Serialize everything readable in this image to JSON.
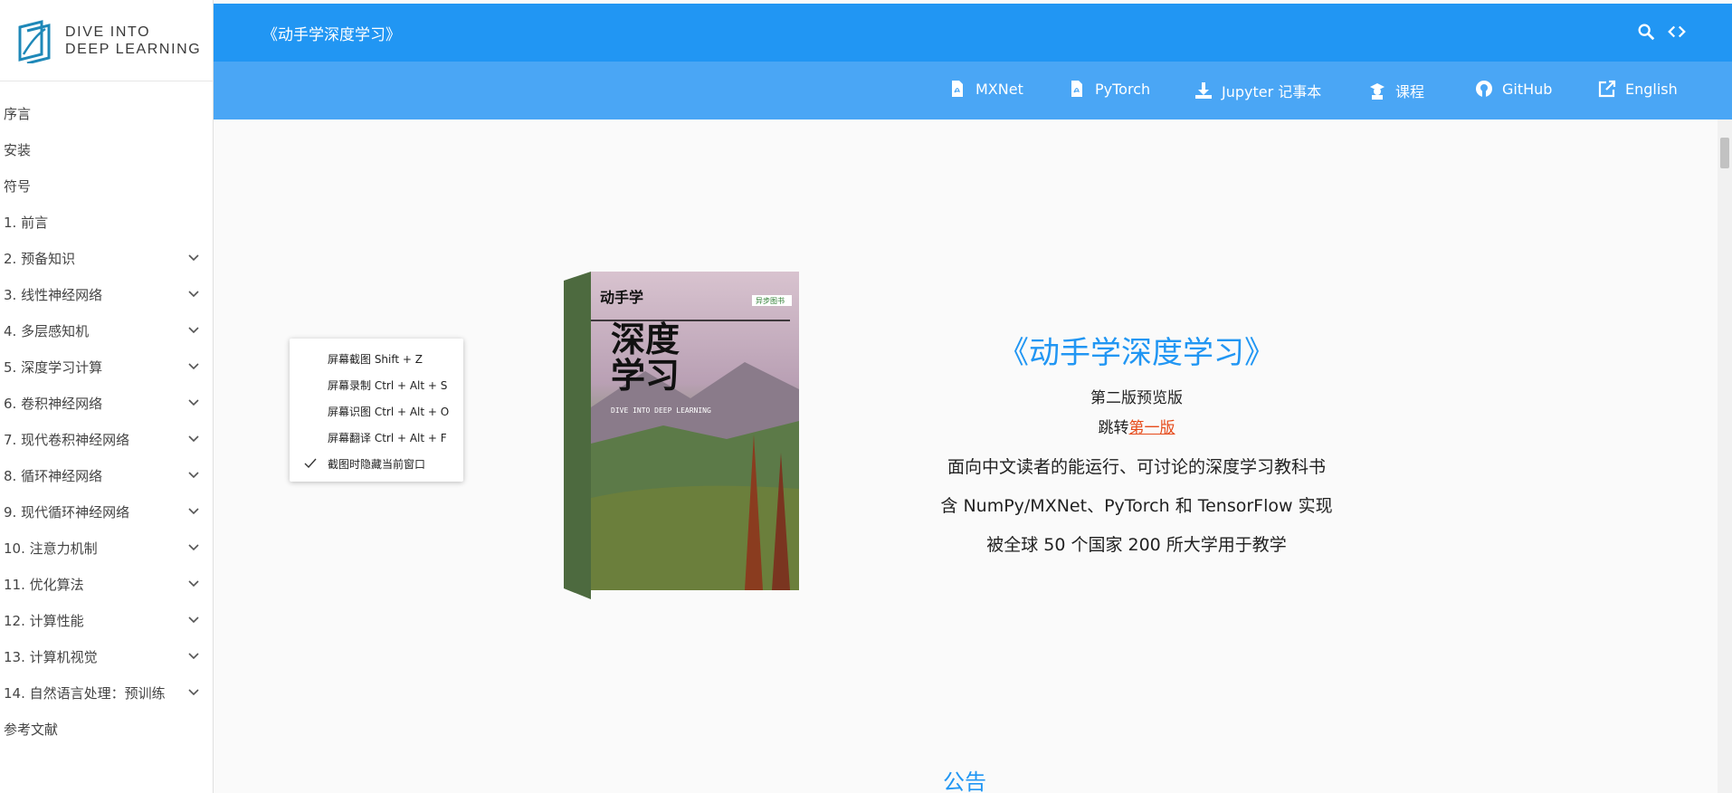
{
  "sidebar": {
    "logo_text_1": "DIVE INTO",
    "logo_text_2": "DEEP LEARNING",
    "items": [
      {
        "label": "序言",
        "expandable": false
      },
      {
        "label": "安装",
        "expandable": false
      },
      {
        "label": "符号",
        "expandable": false
      },
      {
        "label": "1. 前言",
        "expandable": false
      },
      {
        "label": "2. 预备知识",
        "expandable": true
      },
      {
        "label": "3. 线性神经网络",
        "expandable": true
      },
      {
        "label": "4. 多层感知机",
        "expandable": true
      },
      {
        "label": "5. 深度学习计算",
        "expandable": true
      },
      {
        "label": "6. 卷积神经网络",
        "expandable": true
      },
      {
        "label": "7. 现代卷积神经网络",
        "expandable": true
      },
      {
        "label": "8. 循环神经网络",
        "expandable": true
      },
      {
        "label": "9. 现代循环神经网络",
        "expandable": true
      },
      {
        "label": "10. 注意力机制",
        "expandable": true
      },
      {
        "label": "11. 优化算法",
        "expandable": true
      },
      {
        "label": "12. 计算性能",
        "expandable": true
      },
      {
        "label": "13. 计算机视觉",
        "expandable": true
      },
      {
        "label": "14. 自然语言处理：预训练",
        "expandable": true
      },
      {
        "label": "参考文献",
        "expandable": false
      }
    ]
  },
  "header": {
    "title": "《动手学深度学习》",
    "icons": [
      "search-icon",
      "code-icon"
    ]
  },
  "nav": {
    "mxnet": "MXNet",
    "pytorch": "PyTorch",
    "jupyter": "Jupyter 记事本",
    "course": "课程",
    "github": "GitHub",
    "english": "English"
  },
  "hero": {
    "title": "《动手学深度学习》",
    "subtitle": "第二版预览版",
    "jump_prefix": "跳转",
    "jump_link": "第一版",
    "line1": "面向中文读者的能运行、可讨论的深度学习教科书",
    "line2": "含 NumPy/MXNet、PyTorch 和 TensorFlow 实现",
    "line3": "被全球 50 个国家 200 所大学用于教学"
  },
  "book_cover": {
    "title_small": "动手学",
    "title_big1": "深度",
    "title_big2": "学习",
    "subtitle_en": "DIVE INTO DEEP LEARNING",
    "badge": "异步图书"
  },
  "notice_title": "公告",
  "context_menu": {
    "items": [
      {
        "label": "屏幕截图 Shift + Z",
        "checked": false
      },
      {
        "label": "屏幕录制 Ctrl + Alt + S",
        "checked": false
      },
      {
        "label": "屏幕识图 Ctrl + Alt + O",
        "checked": false
      },
      {
        "label": "屏幕翻译 Ctrl + Alt + F",
        "checked": false
      },
      {
        "label": "截图时隐藏当前窗口",
        "checked": true
      }
    ]
  },
  "colors": {
    "primary": "#2196f3",
    "nav_bg": "#4aa6f5",
    "link_accent": "#e64a19"
  }
}
